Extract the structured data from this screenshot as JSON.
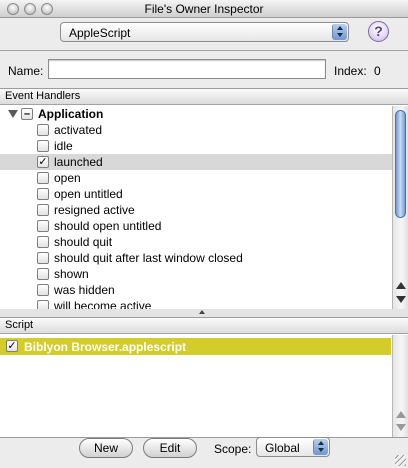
{
  "window": {
    "title": "File's Owner Inspector"
  },
  "toolbar": {
    "inspector_popup_value": "AppleScript",
    "help_label": "?"
  },
  "name_section": {
    "name_label": "Name:",
    "name_value": "",
    "index_label": "Index:",
    "index_value": "0"
  },
  "event_handlers": {
    "header": "Event Handlers",
    "group": {
      "label": "Application",
      "checked": false,
      "mixed": true
    },
    "items": [
      {
        "label": "activated",
        "checked": false,
        "selected": false
      },
      {
        "label": "idle",
        "checked": false,
        "selected": false
      },
      {
        "label": "launched",
        "checked": true,
        "selected": true
      },
      {
        "label": "open",
        "checked": false,
        "selected": false
      },
      {
        "label": "open untitled",
        "checked": false,
        "selected": false
      },
      {
        "label": "resigned active",
        "checked": false,
        "selected": false
      },
      {
        "label": "should open untitled",
        "checked": false,
        "selected": false
      },
      {
        "label": "should quit",
        "checked": false,
        "selected": false
      },
      {
        "label": "should quit after last window closed",
        "checked": false,
        "selected": false
      },
      {
        "label": "shown",
        "checked": false,
        "selected": false
      },
      {
        "label": "was hidden",
        "checked": false,
        "selected": false
      },
      {
        "label": "will become active",
        "checked": false,
        "selected": false
      }
    ]
  },
  "scripts": {
    "header": "Script",
    "items": [
      {
        "label": "Biblyon Browser.applescript",
        "checked": true,
        "selected": true
      }
    ]
  },
  "bottom_bar": {
    "new_label": "New",
    "edit_label": "Edit",
    "scope_label": "Scope:",
    "scope_value": "Global"
  },
  "colors": {
    "script_highlight": "#d4cc2a",
    "scroll_thumb": "#6f9ad4",
    "help_accent": "#5a3e8a"
  }
}
